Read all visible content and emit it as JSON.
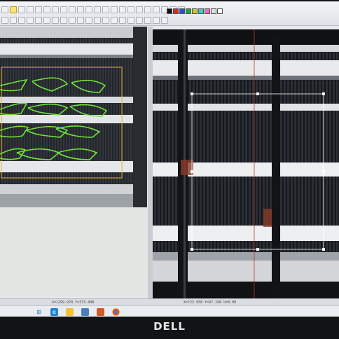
{
  "brand": {
    "logo_text": "DELL"
  },
  "toolbar": {
    "row1_buttons": [
      "select-tool",
      "zoom-in",
      "zoom-out",
      "pan",
      "rotate",
      "mirror",
      "copy",
      "paste",
      "undo",
      "redo",
      "grid",
      "snap",
      "measure",
      "text",
      "line",
      "rect",
      "ellipse",
      "polygon",
      "node-edit",
      "fill",
      "align",
      "distribute"
    ],
    "row2_buttons": [
      "new",
      "open",
      "save",
      "print",
      "cut",
      "delete",
      "group",
      "ungroup",
      "layer",
      "properties",
      "laser",
      "preview",
      "start",
      "pause",
      "stop",
      "frame",
      "origin",
      "home",
      "settings",
      "help"
    ],
    "palette": [
      "#111111",
      "#d42a2a",
      "#2a4fd4",
      "#22a83a",
      "#d4c12a",
      "#2ad4d4",
      "#ff66cc",
      "#e0e0e0",
      "#ffffff"
    ],
    "accent": "#ffe27a"
  },
  "status": {
    "left_text": "X=1299.978 Y=373.408",
    "right_text": "X=723.958 Y=97.198 U=0.00"
  },
  "taskbar": {
    "icons": [
      "windows-start-icon",
      "edge-icon",
      "explorer-icon",
      "folder-icon",
      "cad-app-icon",
      "chrome-icon"
    ]
  }
}
